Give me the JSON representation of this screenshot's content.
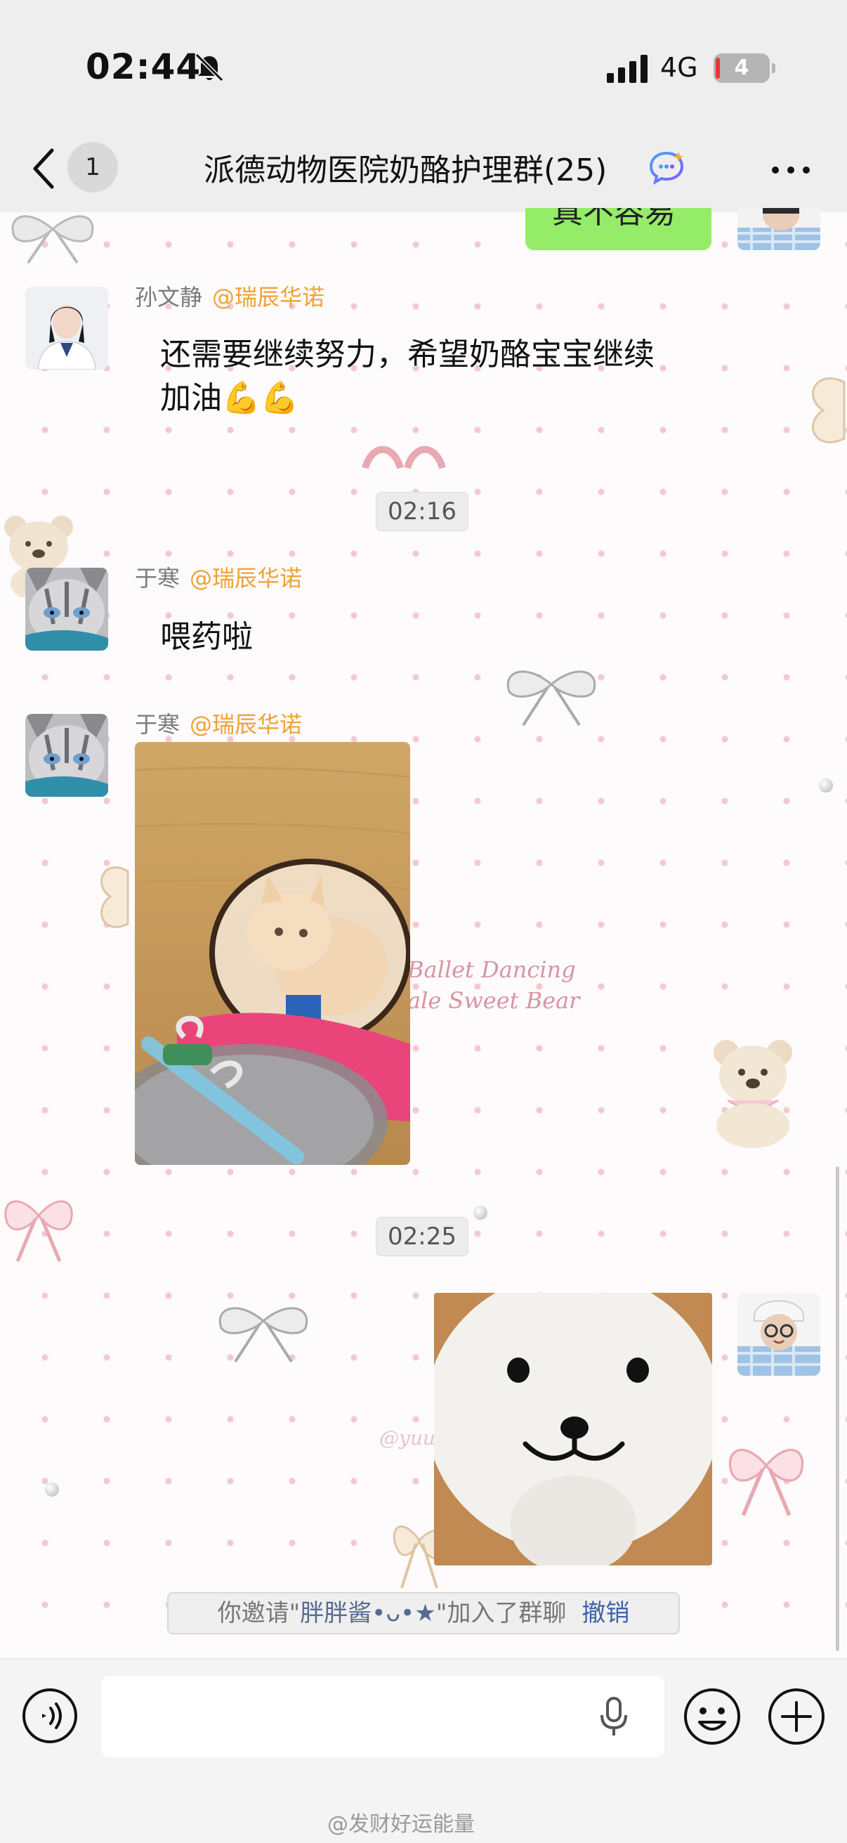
{
  "status_bar": {
    "time": "02:44",
    "network": "4G",
    "battery": "4",
    "icons": [
      "mute-bell-icon",
      "signal-icon",
      "battery-icon"
    ]
  },
  "nav": {
    "unread_count": "1",
    "title": "派德动物医院奶酪护理群(25)",
    "icons": [
      "back-icon",
      "ai-chat-icon",
      "more-icon"
    ]
  },
  "messages": [
    {
      "type": "text",
      "side": "right",
      "text": "真不容易"
    },
    {
      "type": "text",
      "side": "left",
      "sender": "孙文静",
      "mention": "@瑞辰华诺",
      "text_line1": "还需要继续努力，希望奶酪宝宝继续",
      "text_line2": "加油💪💪"
    },
    {
      "type": "time",
      "text": "02:16"
    },
    {
      "type": "text",
      "side": "left",
      "sender": "于寒",
      "mention": "@瑞辰华诺",
      "text": "喂药啦"
    },
    {
      "type": "image",
      "side": "left",
      "sender": "于寒",
      "mention": "@瑞辰华诺",
      "description": "cat in cone collar with syringe"
    },
    {
      "type": "time",
      "text": "02:25"
    },
    {
      "type": "image",
      "side": "right",
      "description": "white plush bear face"
    }
  ],
  "wallpaper_text": {
    "line1": "Ballet Dancing",
    "line2": "ale Sweet Bear",
    "small": "@yuu"
  },
  "system_notice": {
    "prefix": "你邀请\"",
    "name": "胖胖酱•ᴗ•★",
    "suffix": "\"加入了群聊",
    "undo": "撤销"
  },
  "input_bar": {
    "placeholder": "",
    "icons": [
      "voice-icon",
      "mic-icon",
      "emoji-icon",
      "plus-icon"
    ]
  },
  "watermark": "@发财好运能量",
  "colors": {
    "bubble_green": "#95ec69",
    "mention": "#f0a236",
    "link_blue": "#3f62a8",
    "bar_bg": "#eeeeee"
  }
}
